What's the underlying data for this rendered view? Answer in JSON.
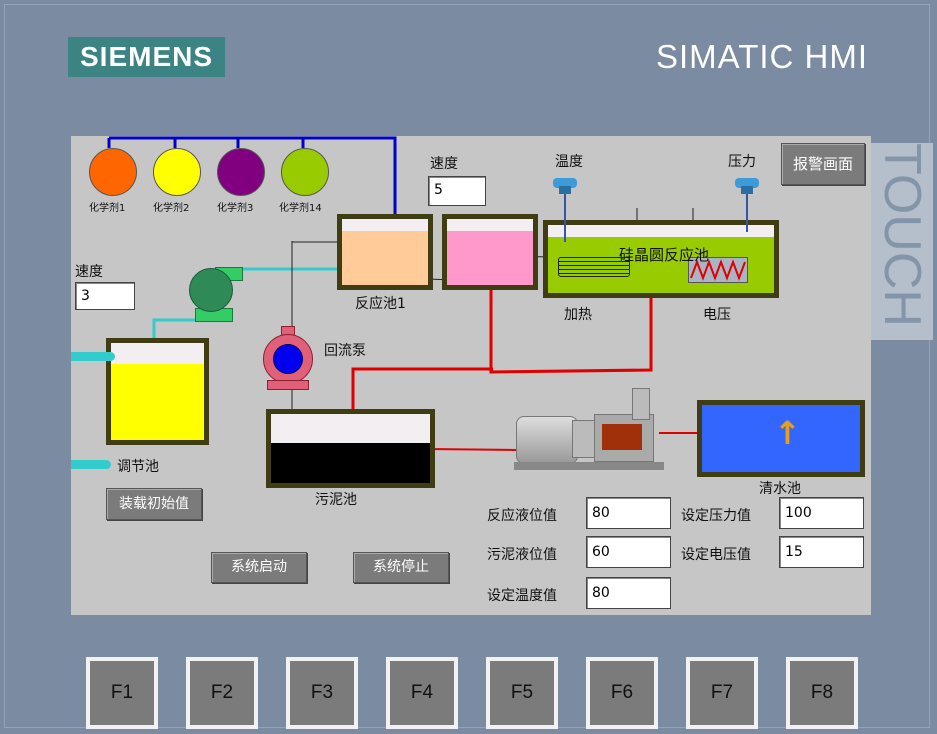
{
  "brand": {
    "logo": "SIEMENS",
    "product": "SIMATIC HMI",
    "touch": "TOUCH"
  },
  "chemicals": [
    {
      "label": "化学剂1",
      "color": "#ff6600"
    },
    {
      "label": "化学剂2",
      "color": "#ffff00"
    },
    {
      "label": "化学剂3",
      "color": "#800080"
    },
    {
      "label": "化学剂14",
      "color": "#99cc00"
    }
  ],
  "speed_label": "速度",
  "speed_left": "3",
  "speed_top": "5",
  "temp_label": "温度",
  "pressure_label": "压力",
  "alarm_button": "报警画面",
  "tanks": {
    "reaction1": "反应池1",
    "wafer": "硅晶圆反应池",
    "adjust": "调节池",
    "sludge": "污泥池",
    "clear": "清水池",
    "return_pump": "回流泵",
    "heating": "加热",
    "voltage": "电压"
  },
  "buttons": {
    "load_init": "装载初始值",
    "start": "系统启动",
    "stop": "系统停止"
  },
  "fields": {
    "reaction_level_label": "反应液位值",
    "reaction_level": "80",
    "sludge_level_label": "污泥液位值",
    "sludge_level": "60",
    "set_temp_label": "设定温度值",
    "set_temp": "80",
    "set_pressure_label": "设定压力值",
    "set_pressure": "100",
    "set_voltage_label": "设定电压值",
    "set_voltage": "15"
  },
  "fkeys": [
    "F1",
    "F2",
    "F3",
    "F4",
    "F5",
    "F6",
    "F7",
    "F8"
  ],
  "colors": {
    "pipe_blue": "#0000cc",
    "pipe_red": "#e00000",
    "pipe_cyan": "#33cccc",
    "tank_border": "#403c14"
  }
}
